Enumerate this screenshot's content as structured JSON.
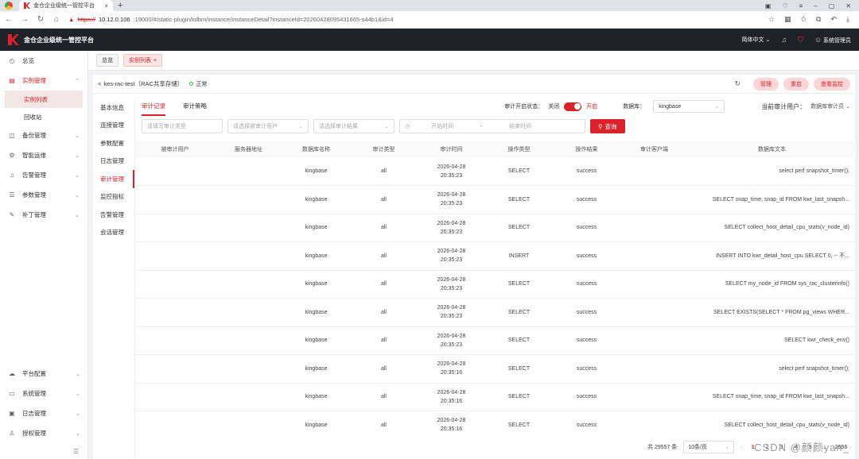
{
  "browser": {
    "tab_title": "金仓企业级统一管控平台",
    "tab_close": "×",
    "new_tab": "+",
    "url_warning": "▲",
    "url_scheme": "https://",
    "url_host": "10.12.0.106",
    "url_rest": ":19000/#/static-plugin/kdbm/instance/instanceDetail?instanceId=20260428095431665-s44b1&id=4"
  },
  "header": {
    "title": "金仓企业级统一管控平台",
    "language": "简体中文",
    "user": "系统管理员"
  },
  "sidebar": {
    "items_top": [
      {
        "icon": "dashboard-icon",
        "glyph": "◴",
        "label": "总览"
      },
      {
        "icon": "instance-icon",
        "glyph": "▤",
        "label": "实例管理",
        "active": true,
        "chev": "⌃"
      }
    ],
    "subitems": [
      {
        "label": "实例列表",
        "active": true
      },
      {
        "label": "回收站"
      }
    ],
    "items_mid": [
      {
        "icon": "backup-icon",
        "glyph": "◫",
        "label": "备份管理",
        "chev": "⌄"
      },
      {
        "icon": "ops-icon",
        "glyph": "⚙",
        "label": "智能运维",
        "chev": "⌄"
      },
      {
        "icon": "alarm-icon",
        "glyph": "♫",
        "label": "告警管理",
        "chev": "⌄"
      },
      {
        "icon": "param-icon",
        "glyph": "☰",
        "label": "参数管理",
        "chev": "⌄"
      },
      {
        "icon": "patch-icon",
        "glyph": "✎",
        "label": "补丁管理",
        "chev": "⌄"
      }
    ],
    "items_bottom": [
      {
        "icon": "cloud-icon",
        "glyph": "☁",
        "label": "平台配置",
        "chev": "⌄"
      },
      {
        "icon": "monitor-icon",
        "glyph": "▭",
        "label": "系统管理",
        "chev": "⌄"
      },
      {
        "icon": "log-icon",
        "glyph": "▣",
        "label": "日志管理",
        "chev": "⌄"
      },
      {
        "icon": "auth-icon",
        "glyph": "♙",
        "label": "授权管理",
        "chev": "⌄"
      }
    ],
    "collapse": "☰"
  },
  "tags": {
    "overview": "总览",
    "instance_list": "实例列表"
  },
  "instance": {
    "back": "<",
    "title": "kes-rac-test（RAC共享存储）",
    "status": "正常",
    "actions": [
      "管理",
      "重启",
      "查看监控"
    ]
  },
  "subnav": [
    "基本信息",
    "连接管理",
    "参数配置",
    "日志管理",
    "审计管理",
    "监控指标",
    "告警管理",
    "会话管理"
  ],
  "subnav_active": 4,
  "panel": {
    "tabs": [
      "审计记录",
      "审计策略"
    ],
    "audit_status_label": "审计开启状态：",
    "off_label": "关闭",
    "on_label": "开启",
    "db_label": "数据库：",
    "db_value": "kingbase",
    "cur_user_label": "当前审计用户：",
    "cur_user_value": "数据库审计员"
  },
  "filters": {
    "type_placeholder": "请填写审计类型",
    "user_placeholder": "请选择被审计用户",
    "result_placeholder": "请选择审计结果",
    "start_placeholder": "开始时间",
    "date_sep": "-",
    "end_placeholder": "结束时间",
    "search_label": "查询"
  },
  "table": {
    "headers": [
      "被审计用户",
      "服务器地址",
      "数据库名称",
      "审计类型",
      "审计时间",
      "操作类型",
      "操作结果",
      "审计客户端",
      "数据库文本"
    ],
    "rows": [
      {
        "user": "",
        "server": "",
        "db": "kingbase",
        "type": "all",
        "date": "2026-04-28",
        "time": "20:35:23",
        "op": "SELECT",
        "result": "success",
        "client": "",
        "sql": "select perf snapshot_timer();"
      },
      {
        "user": "",
        "server": "",
        "db": "kingbase",
        "type": "all",
        "date": "2026-04-28",
        "time": "20:35:23",
        "op": "SELECT",
        "result": "success",
        "client": "",
        "sql": "SELECT snap_time, snap_id FROM kwr_last_snapsh..."
      },
      {
        "user": "",
        "server": "",
        "db": "kingbase",
        "type": "all",
        "date": "2026-04-28",
        "time": "20:35:23",
        "op": "SELECT",
        "result": "success",
        "client": "",
        "sql": "SELECT collect_host_detail_cpu_stats(v_node_id)"
      },
      {
        "user": "",
        "server": "",
        "db": "kingbase",
        "type": "all",
        "date": "2026-04-28",
        "time": "20:35:23",
        "op": "INSERT",
        "result": "success",
        "client": "",
        "sql": "INSERT INTO kwr_detail_host_cpu SELECT 0, -- 不..."
      },
      {
        "user": "",
        "server": "",
        "db": "kingbase",
        "type": "all",
        "date": "2026-04-28",
        "time": "20:35:23",
        "op": "SELECT",
        "result": "success",
        "client": "",
        "sql": "SELECT my_node_id FROM sys_rac_clusterinfo()"
      },
      {
        "user": "",
        "server": "",
        "db": "kingbase",
        "type": "all",
        "date": "2026-04-28",
        "time": "20:35:23",
        "op": "SELECT",
        "result": "success",
        "client": "",
        "sql": "SELECT EXISTS(SELECT * FROM pg_views WHER..."
      },
      {
        "user": "",
        "server": "",
        "db": "kingbase",
        "type": "all",
        "date": "2026-04-28",
        "time": "20:35:23",
        "op": "SELECT",
        "result": "success",
        "client": "",
        "sql": "SELECT kwr_check_env()"
      },
      {
        "user": "",
        "server": "",
        "db": "kingbase",
        "type": "all",
        "date": "2026-04-28",
        "time": "20:35:16",
        "op": "SELECT",
        "result": "success",
        "client": "",
        "sql": "select perf snapshot_timer();"
      },
      {
        "user": "",
        "server": "",
        "db": "kingbase",
        "type": "all",
        "date": "2026-04-28",
        "time": "20:35:16",
        "op": "SELECT",
        "result": "success",
        "client": "",
        "sql": "SELECT snap_time, snap_id FROM kwr_last_snapsh..."
      },
      {
        "user": "",
        "server": "",
        "db": "kingbase",
        "type": "all",
        "date": "2026-04-28",
        "time": "20:35:16",
        "op": "SELECT",
        "result": "success",
        "client": "",
        "sql": "SELECT collect_host_detail_cpu_stats(v_node_id)"
      }
    ]
  },
  "pager": {
    "total": "共 29557 条",
    "page_size": "10条/页",
    "prev": "‹",
    "pages": [
      "1",
      "2",
      "3",
      "4",
      "5",
      "...",
      "2956"
    ],
    "active_page": "1",
    "next": "›"
  },
  "watermark": "CSDN @颜颜yan_"
}
